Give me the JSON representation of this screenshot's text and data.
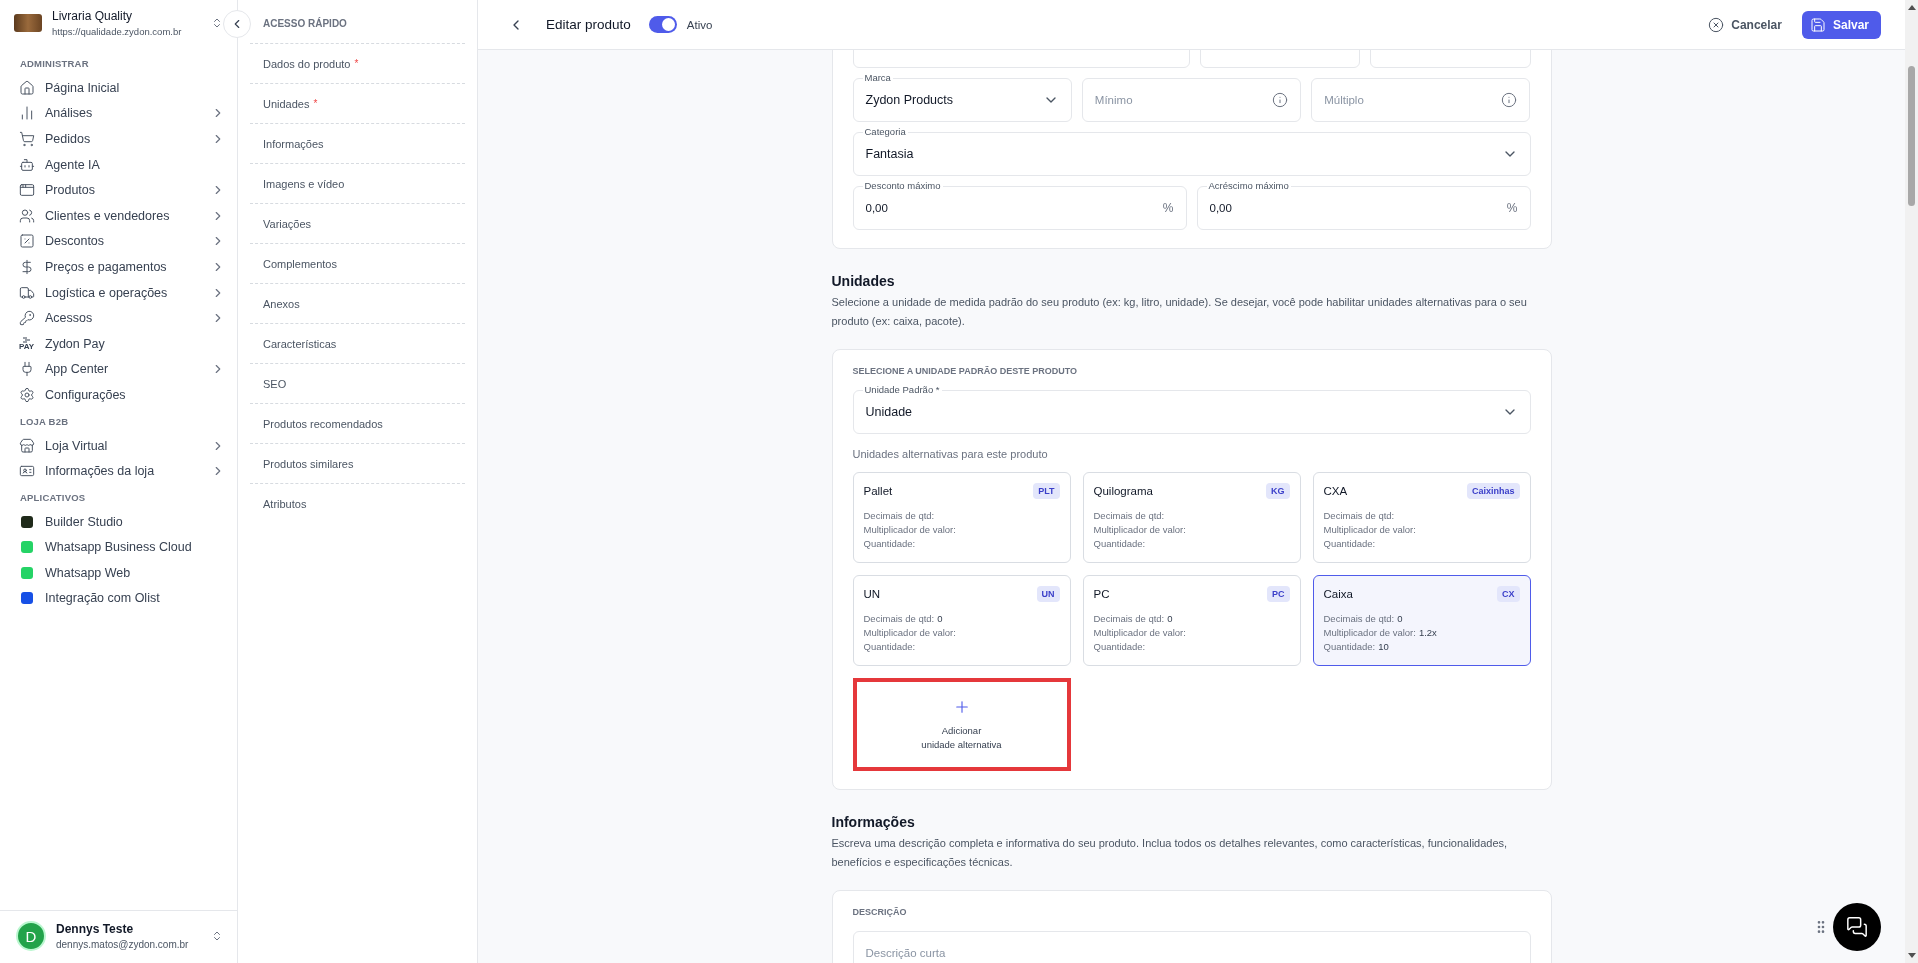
{
  "store": {
    "name": "Livraria Quality",
    "url": "https://qualidade.zydon.com.br"
  },
  "sidebar": {
    "sections": [
      {
        "title": "ADMINISTRAR",
        "items": [
          {
            "label": "Página Inicial",
            "has_submenu": false
          },
          {
            "label": "Análises",
            "has_submenu": true
          },
          {
            "label": "Pedidos",
            "has_submenu": true
          },
          {
            "label": "Agente IA",
            "has_submenu": false
          },
          {
            "label": "Produtos",
            "has_submenu": true
          },
          {
            "label": "Clientes e vendedores",
            "has_submenu": true
          },
          {
            "label": "Descontos",
            "has_submenu": true
          },
          {
            "label": "Preços e pagamentos",
            "has_submenu": true
          },
          {
            "label": "Logística e operações",
            "has_submenu": true
          },
          {
            "label": "Acessos",
            "has_submenu": true
          },
          {
            "label": "Zydon Pay",
            "has_submenu": false,
            "icon_text": "PAY"
          },
          {
            "label": "App Center",
            "has_submenu": true
          },
          {
            "label": "Configurações",
            "has_submenu": false
          }
        ]
      },
      {
        "title": "LOJA B2B",
        "items": [
          {
            "label": "Loja Virtual",
            "has_submenu": true
          },
          {
            "label": "Informações da loja",
            "has_submenu": true
          }
        ]
      },
      {
        "title": "APLICATIVOS",
        "items": [
          {
            "label": "Builder Studio",
            "has_submenu": false,
            "color": "#1f2a1a"
          },
          {
            "label": "Whatsapp Business Cloud",
            "has_submenu": false,
            "color": "#25d366"
          },
          {
            "label": "Whatsapp Web",
            "has_submenu": false,
            "color": "#25d366"
          },
          {
            "label": "Integração com Olist",
            "has_submenu": false,
            "color": "#1750e6"
          }
        ]
      }
    ]
  },
  "user": {
    "initial": "D",
    "name": "Dennys Teste",
    "email": "dennys.matos@zydon.com.br"
  },
  "quick_access": {
    "title": "ACESSO RÁPIDO",
    "items": [
      {
        "label": "Dados do produto",
        "required_mark": "*"
      },
      {
        "label": "Unidades",
        "required_mark": "*"
      },
      {
        "label": "Informações"
      },
      {
        "label": "Imagens e vídeo"
      },
      {
        "label": "Variações"
      },
      {
        "label": "Complementos"
      },
      {
        "label": "Anexos"
      },
      {
        "label": "Características"
      },
      {
        "label": "SEO"
      },
      {
        "label": "Produtos recomendados"
      },
      {
        "label": "Produtos similares"
      },
      {
        "label": "Atributos"
      }
    ]
  },
  "header": {
    "title": "Editar produto",
    "active": true,
    "active_label": "Ativo",
    "cancel": "Cancelar",
    "save": "Salvar"
  },
  "product_form": {
    "field_groups": [
      {
        "fields": [
          {
            "kind": "blank"
          },
          {
            "kind": "blank"
          },
          {
            "kind": "blank"
          }
        ]
      },
      {
        "fields": [
          {
            "kind": "select",
            "label": "Marca",
            "value": "Zydon Products"
          },
          {
            "kind": "input",
            "placeholder": "Mínimo",
            "info": true
          },
          {
            "kind": "input",
            "placeholder": "Múltiplo",
            "info": true
          }
        ]
      },
      {
        "fields": [
          {
            "kind": "select",
            "label": "Categoria",
            "value": "Fantasia"
          }
        ]
      },
      {
        "fields": [
          {
            "kind": "input",
            "label": "Desconto máximo",
            "value": "0,00",
            "suffix": "%"
          },
          {
            "kind": "input",
            "label": "Acréscimo máximo",
            "value": "0,00",
            "suffix": "%"
          }
        ]
      }
    ]
  },
  "units": {
    "title": "Unidades",
    "description": "Selecione a unidade de medida padrão do seu produto (ex: kg, litro, unidade). Se desejar, você pode habilitar unidades alternativas para o seu produto (ex: caixa, pacote).",
    "card_heading": "SELECIONE A UNIDADE PADRÃO DESTE PRODUTO",
    "default_unit": {
      "label": "Unidade Padrão *",
      "value": "Unidade"
    },
    "alternatives_label": "Unidades alternativas para este produto",
    "alternatives": [
      {
        "name": "Pallet",
        "code": "PLT",
        "selected": false,
        "details": [
          {
            "label": "Decimais de qtd:"
          },
          {
            "label": "Multiplicador de valor:"
          },
          {
            "label": "Quantidade:"
          }
        ]
      },
      {
        "name": "Quilograma",
        "code": "KG",
        "selected": false,
        "details": [
          {
            "label": "Decimais de qtd:"
          },
          {
            "label": "Multiplicador de valor:"
          },
          {
            "label": "Quantidade:"
          }
        ]
      },
      {
        "name": "CXA",
        "code": "Caixinhas",
        "selected": false,
        "details": [
          {
            "label": "Decimais de qtd:"
          },
          {
            "label": "Multiplicador de valor:"
          },
          {
            "label": "Quantidade:"
          }
        ]
      },
      {
        "name": "UN",
        "code": "UN",
        "selected": false,
        "details": [
          {
            "label": "Decimais de qtd:",
            "value": "0"
          },
          {
            "label": "Multiplicador de valor:"
          },
          {
            "label": "Quantidade:"
          }
        ]
      },
      {
        "name": "PC",
        "code": "PC",
        "selected": false,
        "details": [
          {
            "label": "Decimais de qtd:",
            "value": "0"
          },
          {
            "label": "Multiplicador de valor:"
          },
          {
            "label": "Quantidade:"
          }
        ]
      },
      {
        "name": "Caixa",
        "code": "CX",
        "selected": true,
        "details": [
          {
            "label": "Decimais de qtd:",
            "value": "0"
          },
          {
            "label": "Multiplicador de valor:",
            "value": "1.2x"
          },
          {
            "label": "Quantidade:",
            "value": "10"
          }
        ]
      }
    ],
    "add_button": {
      "label": "Adicionar\nunidade alternativa",
      "highlighted": true
    }
  },
  "info": {
    "title": "Informações",
    "description": "Escreva uma descrição completa e informativa do seu produto. Inclua todos os detalhes relevantes, como características, funcionalidades, benefícios e especificações técnicas.",
    "card_heading": "DESCRIÇÃO",
    "short_description": {
      "placeholder": "Descrição curta"
    }
  }
}
